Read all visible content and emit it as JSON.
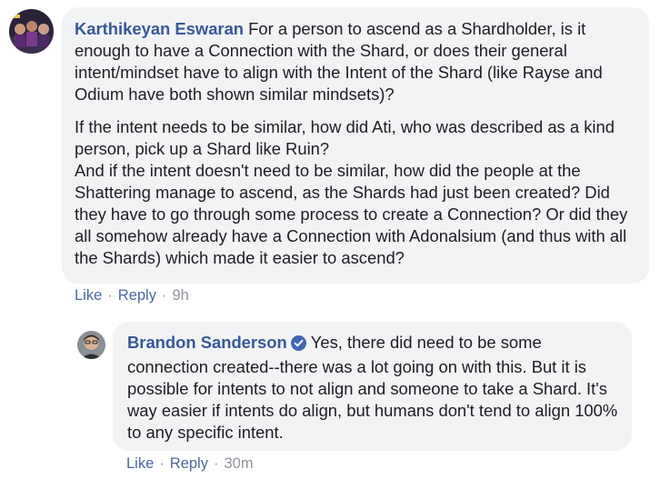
{
  "comments": [
    {
      "author": "Karthikeyan Eswaran",
      "paragraphs": [
        "For a person to ascend as a Shardholder, is it enough to have a Connection with the Shard, or does their general intent/mindset have to align with the Intent of the Shard (like Rayse and Odium have both shown similar mindsets)?",
        "If the intent needs to be similar, how did Ati, who was described as a kind person, pick up a Shard like Ruin?\nAnd if the intent doesn't need to be similar, how did the people at the Shattering manage to ascend, as the Shards had just been created? Did they have to go through some process to create a Connection? Or did they all somehow already have a Connection with Adonalsium (and thus with all the Shards) which made it easier to ascend?"
      ],
      "like_label": "Like",
      "reply_label": "Reply",
      "timestamp": "9h"
    },
    {
      "author": "Brandon Sanderson",
      "verified": true,
      "paragraphs": [
        "Yes, there did need to be some connection created--there was a lot going on with this. But it is possible for intents to not align and someone to take a Shard. It's way easier if intents do align, but humans don't tend to align 100% to any specific intent."
      ],
      "like_label": "Like",
      "reply_label": "Reply",
      "timestamp": "30m"
    }
  ],
  "colors": {
    "author": "#385898",
    "bubble": "#f2f3f5",
    "action_link": "#4b67a1",
    "meta": "#90949c",
    "verified": "#4267b2"
  },
  "icons": {
    "verified": "verified-badge-icon"
  }
}
